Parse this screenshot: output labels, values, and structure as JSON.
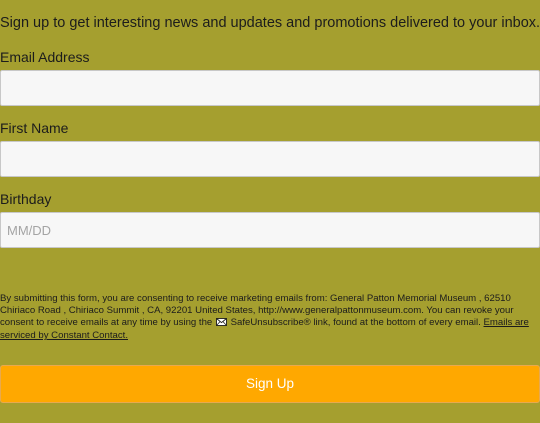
{
  "form": {
    "intro_text": "Sign up to get interesting news and updates and promotions delivered to your inbox.",
    "email": {
      "label": "Email Address",
      "value": "",
      "placeholder": ""
    },
    "first_name": {
      "label": "First Name",
      "value": "",
      "placeholder": ""
    },
    "birthday": {
      "label": "Birthday",
      "value": "",
      "placeholder": "MM/DD"
    },
    "consent": {
      "text_before_icon": "By submitting this form, you are consenting to receive marketing emails from: General Patton Memorial Museum , 62510 Chiriaco Road , Chiriaco Summit , CA, 92201 United States, http://www.generalpattonmuseum.com. You can revoke your consent to receive emails at any time by using the",
      "text_after_icon": "SafeUnsubscribe® link, found at the bottom of every email.",
      "link_text": "Emails are serviced by Constant Contact.",
      "icon": "envelope-icon"
    },
    "submit_label": "Sign Up"
  },
  "colors": {
    "background": "#a59f2f",
    "button": "#ffa800",
    "button_text": "#ffffff",
    "input_background": "#f7f7f7"
  }
}
